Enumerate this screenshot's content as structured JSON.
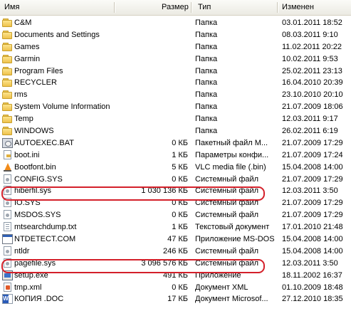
{
  "header": {
    "name": "Имя",
    "size": "Размер",
    "type": "Тип",
    "modified": "Изменен"
  },
  "files": [
    {
      "name": "C&M",
      "size": "",
      "type": "Папка",
      "modified": "03.01.2011 18:52",
      "icon": "folder-icon"
    },
    {
      "name": "Documents and Settings",
      "size": "",
      "type": "Папка",
      "modified": "08.03.2011 9:10",
      "icon": "folder-icon"
    },
    {
      "name": "Games",
      "size": "",
      "type": "Папка",
      "modified": "11.02.2011 20:22",
      "icon": "folder-icon"
    },
    {
      "name": "Garmin",
      "size": "",
      "type": "Папка",
      "modified": "10.02.2011 9:53",
      "icon": "folder-icon"
    },
    {
      "name": "Program Files",
      "size": "",
      "type": "Папка",
      "modified": "25.02.2011 23:13",
      "icon": "folder-icon"
    },
    {
      "name": "RECYCLER",
      "size": "",
      "type": "Папка",
      "modified": "16.04.2010 20:39",
      "icon": "folder-icon"
    },
    {
      "name": "rms",
      "size": "",
      "type": "Папка",
      "modified": "23.10.2010 20:10",
      "icon": "folder-icon"
    },
    {
      "name": "System Volume Information",
      "size": "",
      "type": "Папка",
      "modified": "21.07.2009 18:06",
      "icon": "folder-icon"
    },
    {
      "name": "Temp",
      "size": "",
      "type": "Папка",
      "modified": "12.03.2011 9:17",
      "icon": "folder-icon"
    },
    {
      "name": "WINDOWS",
      "size": "",
      "type": "Папка",
      "modified": "26.02.2011 6:19",
      "icon": "folder-icon"
    },
    {
      "name": "AUTOEXEC.BAT",
      "size": "0 КБ",
      "type": "Пакетный файл M...",
      "modified": "21.07.2009 17:29",
      "icon": "batch-file-icon"
    },
    {
      "name": "boot.ini",
      "size": "1 КБ",
      "type": "Параметры конфи...",
      "modified": "21.07.2009 17:24",
      "icon": "ini-file-icon"
    },
    {
      "name": "Bootfont.bin",
      "size": "5 КБ",
      "type": "VLC media file (.bin)",
      "modified": "15.04.2008 14:00",
      "icon": "vlc-file-icon"
    },
    {
      "name": "CONFIG.SYS",
      "size": "0 КБ",
      "type": "Системный файл",
      "modified": "21.07.2009 17:29",
      "icon": "system-file-icon"
    },
    {
      "name": "hiberfil.sys",
      "size": "1 030 136 КБ",
      "type": "Системный файл",
      "modified": "12.03.2011 3:50",
      "icon": "system-file-icon"
    },
    {
      "name": "IO.SYS",
      "size": "0 КБ",
      "type": "Системный файл",
      "modified": "21.07.2009 17:29",
      "icon": "system-file-icon"
    },
    {
      "name": "MSDOS.SYS",
      "size": "0 КБ",
      "type": "Системный файл",
      "modified": "21.07.2009 17:29",
      "icon": "system-file-icon"
    },
    {
      "name": "mtsearchdump.txt",
      "size": "1 КБ",
      "type": "Текстовый документ",
      "modified": "17.01.2010 21:48",
      "icon": "text-file-icon"
    },
    {
      "name": "NTDETECT.COM",
      "size": "47 КБ",
      "type": "Приложение MS-DOS",
      "modified": "15.04.2008 14:00",
      "icon": "com-file-icon"
    },
    {
      "name": "ntldr",
      "size": "246 КБ",
      "type": "Системный файл",
      "modified": "15.04.2008 14:00",
      "icon": "system-file-icon"
    },
    {
      "name": "pagefile.sys",
      "size": "3 096 576 КБ",
      "type": "Системный файл",
      "modified": "12.03.2011 3:50",
      "icon": "system-file-icon"
    },
    {
      "name": "setup.exe",
      "size": "491 КБ",
      "type": "Приложение",
      "modified": "18.11.2002 16:37",
      "icon": "exe-file-icon"
    },
    {
      "name": "tmp.xml",
      "size": "0 КБ",
      "type": "Документ XML",
      "modified": "01.10.2009 18:48",
      "icon": "xml-file-icon"
    },
    {
      "name": "КОПИЯ .DOC",
      "size": "17 КБ",
      "type": "Документ Microsof...",
      "modified": "27.12.2010 18:35",
      "icon": "word-document-icon"
    }
  ],
  "highlighted_rows": [
    "hiberfil.sys",
    "pagefile.sys"
  ],
  "colors": {
    "highlight": "#d4202a",
    "folder": "#eec24c"
  }
}
